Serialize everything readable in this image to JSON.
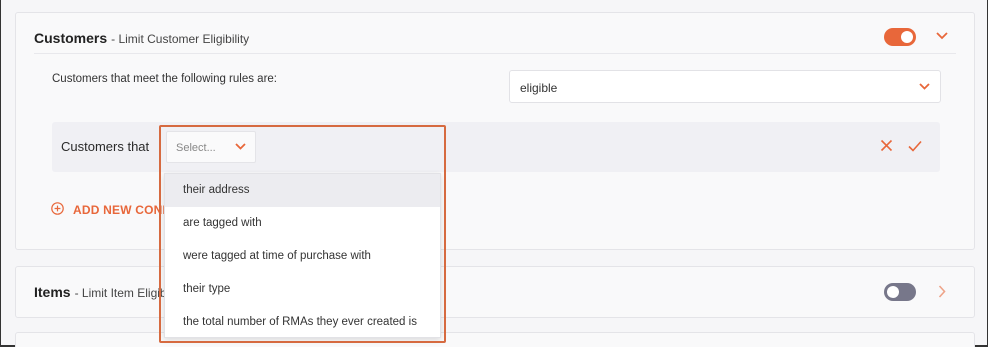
{
  "customers_card": {
    "title": "Customers",
    "subtitle": "- Limit Customer Eligibility",
    "toggle_on": true,
    "rules_label": "Customers that meet the following rules are:",
    "eligibility_value": "eligible",
    "condition": {
      "label": "Customers that",
      "select_placeholder": "Select..."
    },
    "add_condition_label": "ADD NEW CONDITION"
  },
  "dropdown": {
    "options": [
      "their address",
      "are tagged with",
      "were tagged at time of purchase with",
      "their type",
      "the total number of RMAs they ever created is"
    ],
    "hovered_index": 0
  },
  "items_card": {
    "title": "Items",
    "subtitle": "- Limit Item Eligibility",
    "toggle_on": false
  },
  "colors": {
    "accent": "#e8673a",
    "toggle_off": "#77778a",
    "highlight_border": "#d66a40"
  },
  "icons": [
    "chevron-down-icon",
    "chevron-right-icon",
    "close-icon",
    "check-icon",
    "plus-circle-icon"
  ]
}
